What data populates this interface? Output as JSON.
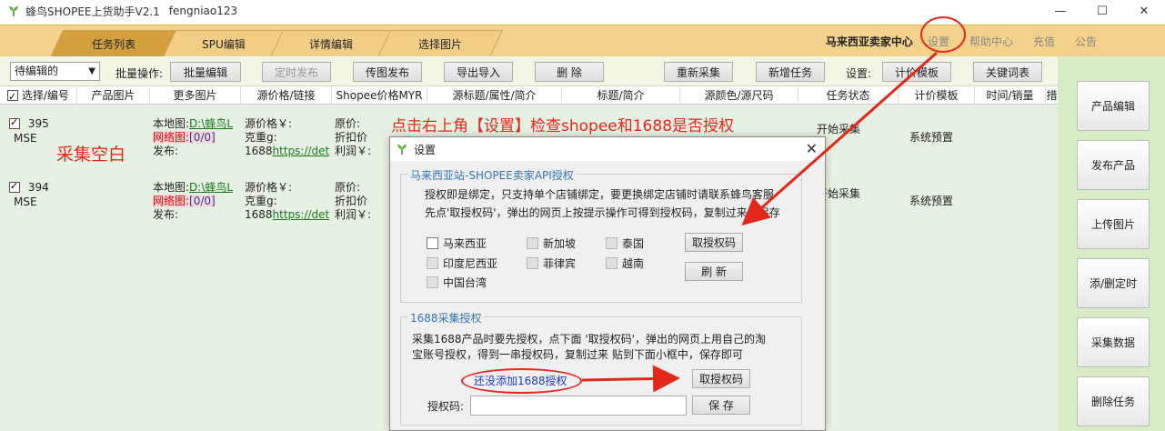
{
  "window": {
    "title": "蜂鸟SHOPEE上货助手V2.1",
    "user": "fengniao123",
    "minimize": "—",
    "maximize": "☐",
    "close": "✕"
  },
  "tabs": [
    {
      "label": "任务列表",
      "active": true
    },
    {
      "label": "SPU编辑",
      "active": false
    },
    {
      "label": "详情编辑",
      "active": false
    },
    {
      "label": "选择图片",
      "active": false
    }
  ],
  "top_nav": {
    "shop_center": "马来西亚卖家中心",
    "settings": "设置",
    "help": "帮助中心",
    "recharge": "充值",
    "notice": "公告"
  },
  "toolbar": {
    "filter_value": "待编辑的",
    "batch_label": "批量操作:",
    "batch_edit": "批量编辑",
    "schedule_publish": "定时发布",
    "upload_publish": "传图发布",
    "export_import": "导出导入",
    "delete": "删 除",
    "recollect": "重新采集",
    "new_task": "新增任务",
    "settings_label": "设置:",
    "price_template": "计价模板",
    "keywords": "关键词表"
  },
  "columns": [
    "选择/编号",
    "产品图片",
    "更多图片",
    "源价格/链接",
    "Shopee价格MYR",
    "源标题/属性/简介",
    "标题/简介",
    "源颜色/源尺码",
    "任务状态",
    "计价模板",
    "时间/销量",
    "措"
  ],
  "rows": [
    {
      "id": "395",
      "site": "MSE",
      "local_label": "本地图:",
      "local_path": "D:\\蜂鸟L",
      "net_label": "网络图:",
      "net_value": "[0/0]",
      "publish_label": "发布:",
      "src_price": "源价格￥:",
      "weight": "克重g:",
      "link_prefix": "1688",
      "link": "https://det",
      "orig_price": "原价:",
      "discount_price": "折扣价",
      "profit": "利润￥:",
      "status": "开始采集",
      "template": "系统预置"
    },
    {
      "id": "394",
      "site": "MSE",
      "local_label": "本地图:",
      "local_path": "D:\\蜂鸟L",
      "net_label": "网络图:",
      "net_value": "[0/0]",
      "publish_label": "发布:",
      "src_price": "源价格￥:",
      "weight": "克重g:",
      "link_prefix": "1688",
      "link": "https://det",
      "orig_price": "原价:",
      "discount_price": "折扣价",
      "profit": "利润￥:",
      "status": "开始采集",
      "template": "系统预置"
    }
  ],
  "annotations": {
    "empty_collect": "采集空白",
    "instruction": "点击右上角【设置】检查shopee和1688是否授权"
  },
  "sidebar": [
    "产品编辑",
    "发布产品",
    "上传图片",
    "添/删定时",
    "采集数据",
    "删除任务"
  ],
  "dialog": {
    "title": "设置",
    "close": "✕",
    "shopee_group": {
      "title": "马来西亚站-SHOPEE卖家API授权",
      "desc1": "授权即是绑定，只支持单个店铺绑定，要更换绑定店铺时请联系蜂鸟客服",
      "desc2": "先点'取授权码'，弹出的网页上按提示操作可得到授权码，复制过来并保存",
      "countries": [
        "马来西亚",
        "新加坡",
        "泰国",
        "印度尼西亚",
        "菲律宾",
        "越南",
        "中国台湾"
      ],
      "get_code": "取授权码",
      "refresh": "刷 新"
    },
    "ali_group": {
      "title": "1688采集授权",
      "desc1": "采集1688产品时要先授权，点下面 '取授权码'，弹出的网页上用自己的淘",
      "desc2": "宝账号授权，得到一串授权码，复制过来 贴到下面小框中，保存即可",
      "status": "还没添加1688授权",
      "get_code": "取授权码",
      "code_label": "授权码:",
      "code_value": "",
      "save": "保 存"
    }
  },
  "colors": {
    "tab_bar": "#f5d28c",
    "active_tab": "#d4a03e",
    "grid_bg": "#e7f1e3",
    "sidebar_bg": "#d7ebc5",
    "annotation_red": "#e3271b",
    "group_title_blue": "#3573b7"
  }
}
